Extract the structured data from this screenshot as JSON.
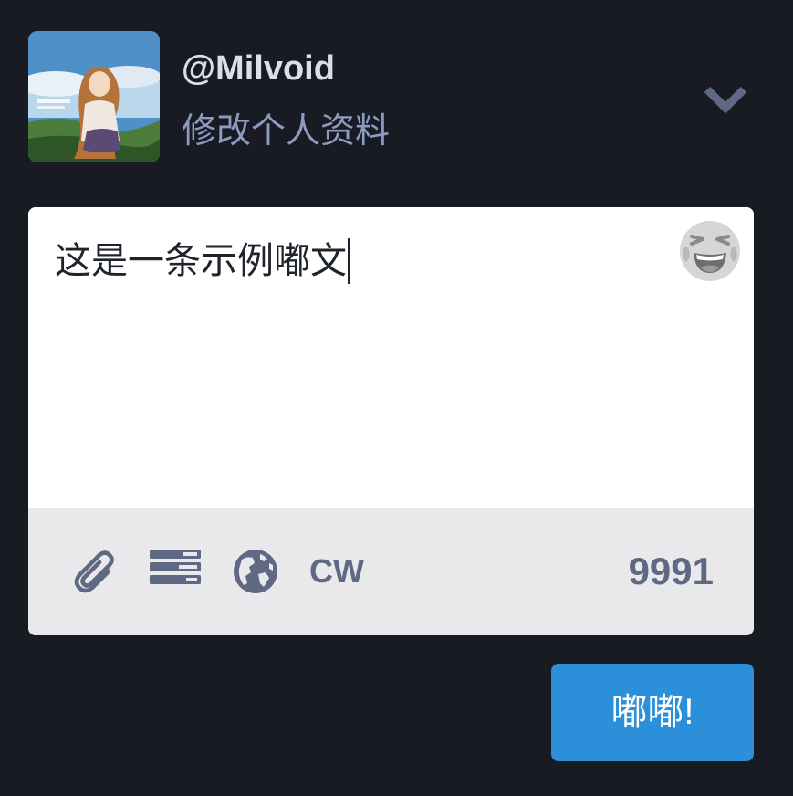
{
  "account": {
    "handle": "@Milvoid",
    "edit_profile_label": "修改个人资料"
  },
  "compose": {
    "text": "这是一条示例嘟文",
    "emoji_icon": "laughing-face-icon",
    "toolbar": {
      "attach_icon": "paperclip-icon",
      "poll_icon": "poll-list-icon",
      "privacy_icon": "globe-icon",
      "cw_label": "CW",
      "char_count": "9991"
    }
  },
  "publish_label": "嘟嘟!",
  "colors": {
    "background": "#191b22",
    "accent": "#2b90d9",
    "muted": "#606984",
    "link": "#8d9ac2"
  }
}
